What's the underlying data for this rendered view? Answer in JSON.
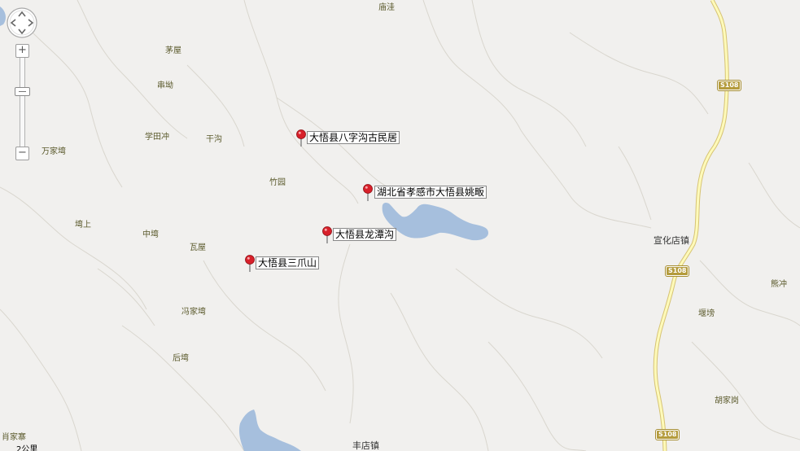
{
  "map": {
    "place_names": [
      "庙洼",
      "茅屋",
      "串坳",
      "学田冲",
      "干沟",
      "万家塆",
      "竹园",
      "塆上",
      "中塆",
      "瓦屋",
      "冯家塆",
      "后塆",
      "肖家寨",
      "熊冲",
      "堰塝",
      "胡家岗"
    ],
    "towns": [
      "宣化店镇",
      "丰店镇"
    ],
    "road_shields": [
      "S108",
      "S108",
      "S108"
    ],
    "markers": [
      "大悟县八字沟古民居",
      "湖北省孝感市大悟县姚畈",
      "大悟县龙潭沟",
      "大悟县三爪山"
    ],
    "scale": "2公里"
  },
  "colors": {
    "background": "#f1f0ee",
    "water": "#a6bfdd",
    "road_fill": "#fefab9",
    "road_edge": "#d6c375",
    "contour": "#dad7cf",
    "marker": "#d8202a"
  },
  "icons": {
    "pan": "pan-control-icon",
    "zoom_in": "plus-icon",
    "zoom_out": "minus-icon",
    "marker": "map-pin-icon"
  }
}
